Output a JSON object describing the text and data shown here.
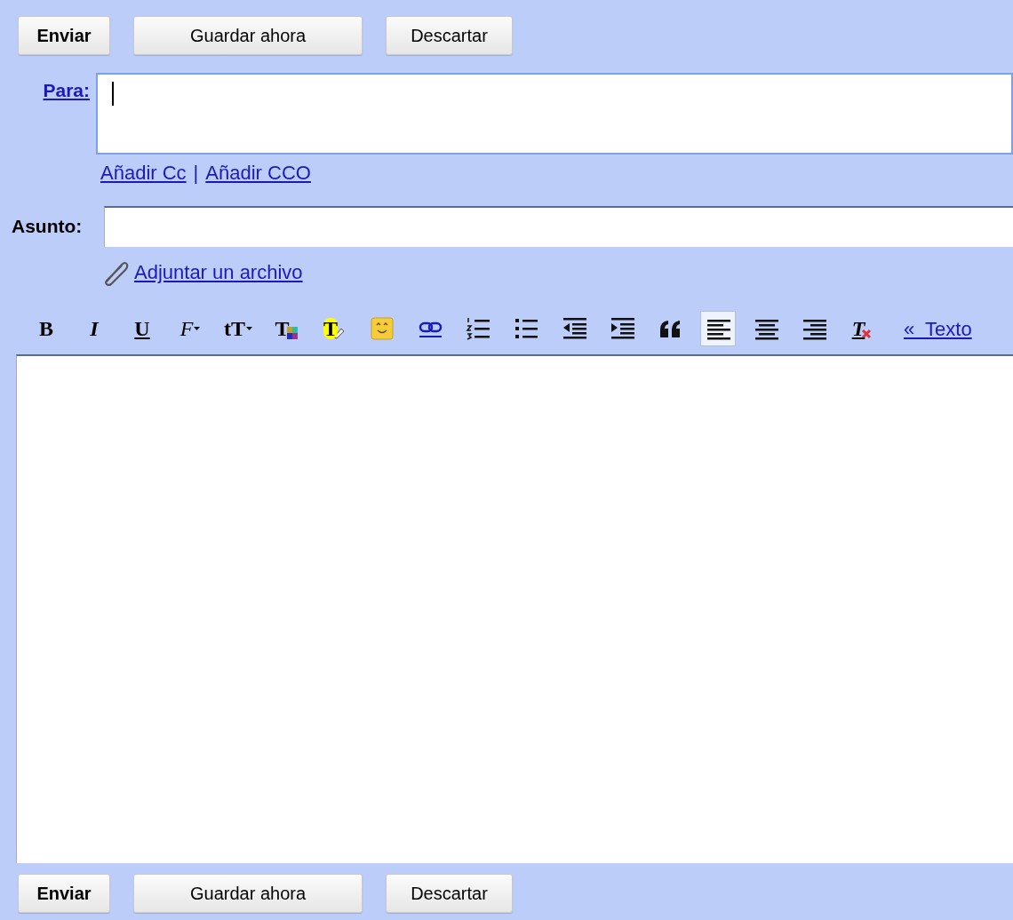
{
  "top_buttons": [
    {
      "label": "Enviar",
      "primary": true
    },
    {
      "label": "Guardar ahora",
      "primary": false
    },
    {
      "label": "Descartar",
      "primary": false
    }
  ],
  "to": {
    "label": "Para:",
    "focused": true
  },
  "recipient_links": [
    {
      "label": "Añadir Cc"
    },
    {
      "label": "Añadir CCO"
    }
  ],
  "recipient_separator": "|",
  "subject": {
    "label": "Asunto:"
  },
  "attach_link": "Adjuntar un archivo",
  "toolbar": [
    {
      "kind": "bold",
      "glyph": "B",
      "selected": false
    },
    {
      "kind": "italic",
      "glyph": "I",
      "selected": false
    },
    {
      "kind": "underline",
      "glyph": "U",
      "selected": false
    },
    {
      "kind": "font",
      "glyph": "F",
      "selected": false
    },
    {
      "kind": "size",
      "glyph": "tT",
      "selected": false
    },
    {
      "kind": "color",
      "glyph": "T",
      "selected": false
    },
    {
      "kind": "highlight",
      "glyph": "T",
      "selected": false
    },
    {
      "kind": "emoji",
      "selected": false
    },
    {
      "kind": "link",
      "selected": false
    },
    {
      "kind": "numbered",
      "selected": false
    },
    {
      "kind": "bullets",
      "selected": false
    },
    {
      "kind": "outdent",
      "selected": false
    },
    {
      "kind": "indent",
      "selected": false
    },
    {
      "kind": "quote",
      "selected": false
    },
    {
      "kind": "align-left",
      "selected": true
    },
    {
      "kind": "align-center",
      "selected": false
    },
    {
      "kind": "align-right",
      "selected": false
    },
    {
      "kind": "clear",
      "glyph": "T",
      "selected": false
    }
  ],
  "plain_text_link": "«  Texto",
  "bottom_buttons": [
    {
      "label": "Enviar",
      "primary": true
    },
    {
      "label": "Guardar ahora",
      "primary": false
    },
    {
      "label": "Descartar",
      "primary": false
    }
  ]
}
